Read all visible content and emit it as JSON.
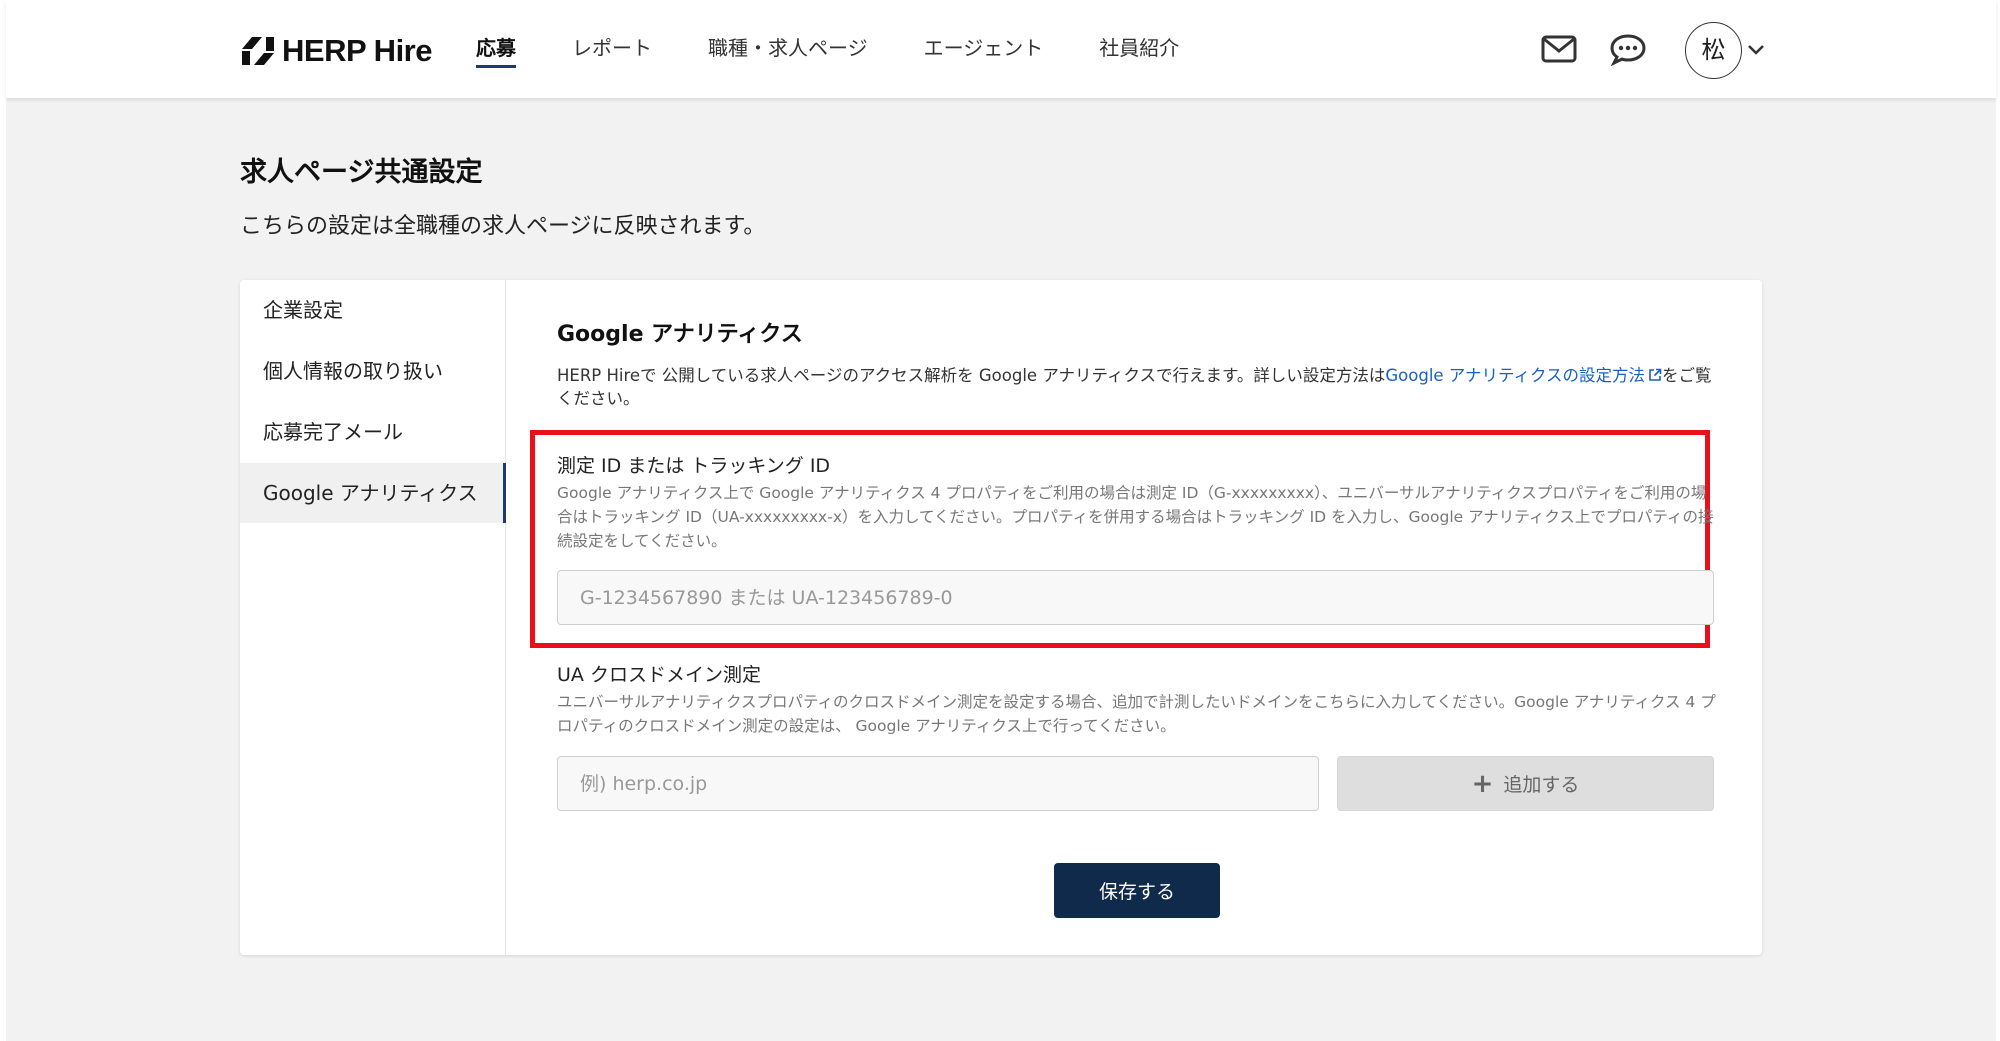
{
  "header": {
    "logo_text": "HERP Hire",
    "nav": [
      {
        "label": "応募",
        "active": true
      },
      {
        "label": "レポート"
      },
      {
        "label": "職種・求人ページ"
      },
      {
        "label": "エージェント"
      },
      {
        "label": "社員紹介"
      }
    ],
    "icons": [
      "mail-icon",
      "chat-icon"
    ],
    "avatar_char": "松"
  },
  "page": {
    "title": "求人ページ共通設定",
    "subtitle": "こちらの設定は全職種の求人ページに反映されます。"
  },
  "sidebar": {
    "items": [
      {
        "label": "企業設定"
      },
      {
        "label": "個人情報の取り扱い"
      },
      {
        "label": "応募完了メール"
      },
      {
        "label": "Google アナリティクス",
        "active": true
      }
    ]
  },
  "section": {
    "title": "Google アナリティクス",
    "desc_before": "HERP Hireで 公開している求人ページのアクセス解析を Google アナリティクスで行えます。詳しい設定方法は",
    "desc_link": "Google アナリティクスの設定方法",
    "desc_after": "をご覧ください。"
  },
  "tracking": {
    "label": "測定 ID または トラッキング ID",
    "help": "Google アナリティクス上で Google アナリティクス 4 プロパティをご利用の場合は測定 ID（G-xxxxxxxxx）、ユニバーサルアナリティクスプロパティをご利用の場合はトラッキング ID（UA-xxxxxxxxx-x）を入力してください。プロパティを併用する場合はトラッキング ID を入力し、Google アナリティクス上でプロパティの接続設定をしてください。",
    "placeholder": "G-1234567890 または UA-123456789-0",
    "value": ""
  },
  "cross_domain": {
    "label": "UA クロスドメイン測定",
    "help": "ユニバーサルアナリティクスプロパティのクロスドメイン測定を設定する場合、追加で計測したいドメインをこちらに入力してください。Google アナリティクス 4 プロパティのクロスドメイン測定の設定は、 Google アナリティクス上で行ってください。",
    "placeholder": "例) herp.co.jp",
    "add_label": "追加する"
  },
  "save_label": "保存する",
  "colors": {
    "accent": "#1e3a6e",
    "save_button": "#102a4c",
    "highlight": "#e8101a",
    "link": "#1a5fc4"
  }
}
